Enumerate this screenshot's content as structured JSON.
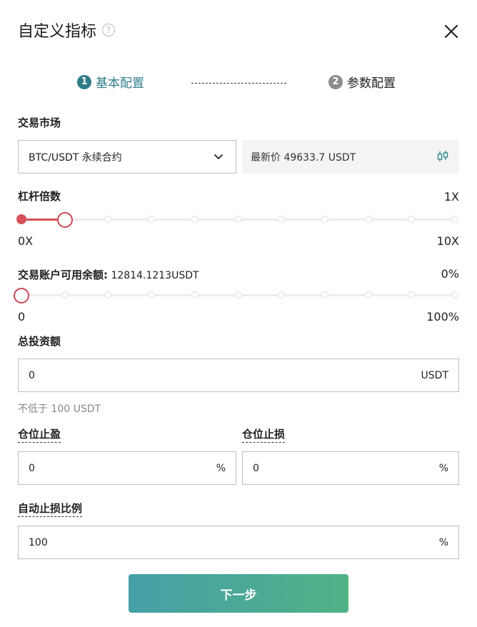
{
  "dialog": {
    "title": "自定义指标",
    "help_glyph": "?"
  },
  "steps": [
    {
      "number": "1",
      "label": "基本配置",
      "active": true
    },
    {
      "number": "2",
      "label": "参数配置",
      "active": false
    }
  ],
  "market": {
    "label": "交易市场",
    "selected": "BTC/USDT 永续合约",
    "latest_price": "最新价 49633.7 USDT"
  },
  "leverage": {
    "label": "杠杆倍数",
    "current": "1X",
    "min_label": "0X",
    "max_label": "10X",
    "value": 1,
    "max": 10
  },
  "balance": {
    "label": "交易账户可用余额:",
    "amount": "12814.1213USDT",
    "percent": "0%",
    "min_label": "0",
    "max_label": "100%",
    "value": 0,
    "max": 10
  },
  "investment": {
    "label": "总投资额",
    "value": "0",
    "unit": "USDT",
    "hint": "不低于 100 USDT"
  },
  "take_profit": {
    "label": "仓位止盈",
    "value": "0",
    "unit": "%"
  },
  "stop_loss": {
    "label": "仓位止损",
    "value": "0",
    "unit": "%"
  },
  "auto_stop_loss": {
    "label": "自动止损比例",
    "value": "100",
    "unit": "%"
  },
  "next_button": "下一步",
  "colors": {
    "accent": "#2f7d89",
    "slider": "#d5505a",
    "button_start": "#46a0a8",
    "button_end": "#4fb285"
  }
}
